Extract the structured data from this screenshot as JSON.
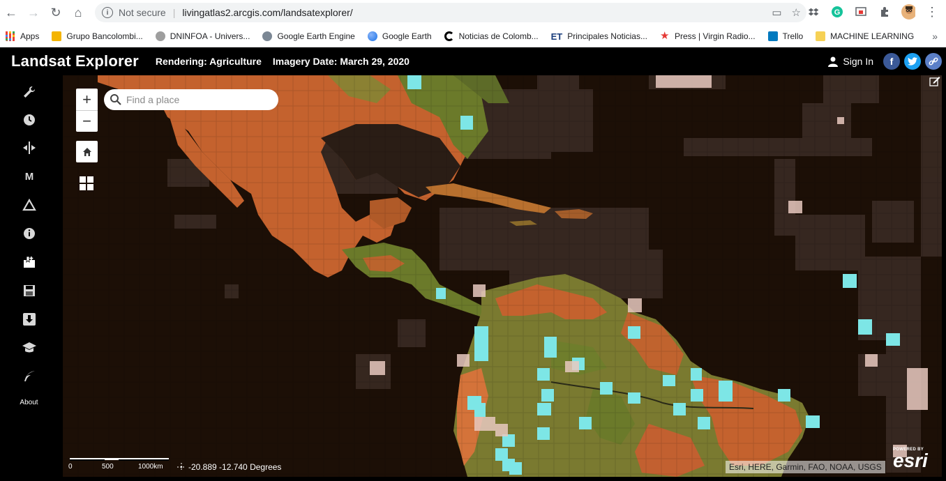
{
  "browser": {
    "security_label": "Not secure",
    "url": "livingatlas2.arcgis.com/landsatexplorer/",
    "bookmarks": [
      {
        "label": "Apps",
        "color": "#1a73e8"
      },
      {
        "label": "Grupo Bancolombi...",
        "color": "#f4b400"
      },
      {
        "label": "DNINFOA - Univers...",
        "color": "#777777"
      },
      {
        "label": "Google Earth Engine",
        "color": "#5f6368"
      },
      {
        "label": "Google Earth",
        "color": "#4285f4"
      },
      {
        "label": "Noticias de Colomb...",
        "color": "#000000"
      },
      {
        "label": "Principales Noticias...",
        "color": "#1a3d7c"
      },
      {
        "label": "Press | Virgin Radio...",
        "color": "#e53935"
      },
      {
        "label": "Trello",
        "color": "#0079bf"
      },
      {
        "label": "MACHINE LEARNING",
        "color": "#f6d155"
      }
    ],
    "bookmarks_more": "»"
  },
  "header": {
    "title": "Landsat Explorer",
    "rendering": "Rendering: Agriculture",
    "imagery_date": "Imagery Date: March 29, 2020",
    "sign_in": "Sign In",
    "facebook_color": "#3b5998",
    "twitter_color": "#1da1f2",
    "link_color": "#5b7fc7"
  },
  "sidebar": {
    "buttons": [
      "wrench-icon",
      "clock-icon",
      "compare-icon",
      "m-icon",
      "triangle-icon",
      "info-icon",
      "bookmark-add-icon",
      "save-icon",
      "download-icon",
      "education-icon",
      "quill-icon"
    ],
    "m_label": "M",
    "about": "About"
  },
  "map": {
    "search_placeholder": "Find a place",
    "zoom_in": "+",
    "zoom_out": "−",
    "scale_labels": [
      "0",
      "500",
      "1000km"
    ],
    "coordinates": "-20.889 -12.740 Degrees",
    "attribution": "Esri, HERE, Garmin, FAO, NOAA, USGS",
    "esri_powered": "POWERED BY",
    "esri_word": "esri",
    "land_color": "#c4622e",
    "veg_color": "#6b7a2a",
    "ocean_color": "#1c0f06"
  }
}
